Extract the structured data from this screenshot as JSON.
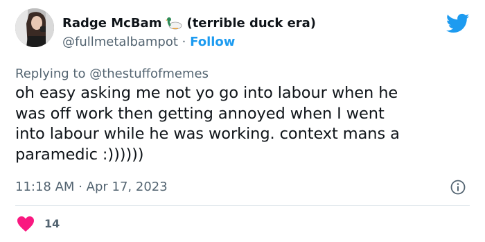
{
  "author": {
    "display_name": "Radge McBam",
    "name_suffix": "(terrible duck era)",
    "handle": "@fullmetalbampot",
    "separator": "·",
    "follow_label": "Follow"
  },
  "reply": {
    "prefix": "Replying to",
    "mention": "@thestuffofmemes"
  },
  "tweet": {
    "lines": [
      "oh easy asking me not yo go into labour when he",
      "was off work then getting annoyed when I went",
      "into labour while he was working. context mans a",
      "paramedic :))))))"
    ]
  },
  "meta": {
    "time": "11:18 AM",
    "separator": "·",
    "date": "Apr 17, 2023"
  },
  "engagement": {
    "likes": "14"
  },
  "icons": {
    "brand": "twitter-bird-icon",
    "name_emoji": "duck-icon",
    "info": "info-icon",
    "like": "heart-icon"
  },
  "colors": {
    "twitter_blue": "#1d9bf0",
    "heart": "#f91880",
    "secondary_text": "#536471",
    "primary_text": "#0f1419"
  }
}
